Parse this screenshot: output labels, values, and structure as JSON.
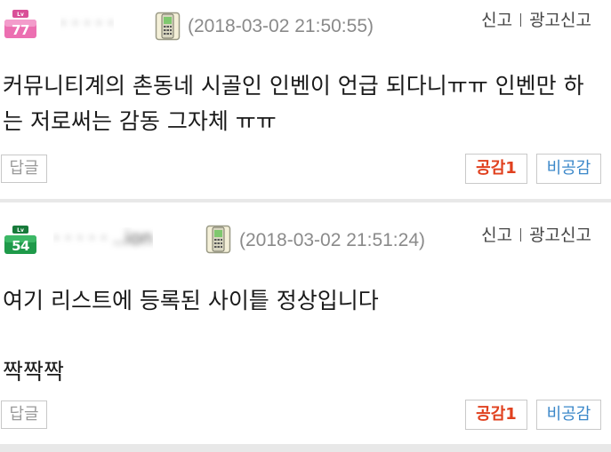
{
  "comments": [
    {
      "level": "77",
      "level_tag": "Lv",
      "badge_color": "#ec6fb1",
      "username": "·  ·  · ·  ·",
      "device_icon": "mobile-phone-icon",
      "timestamp": "(2018-03-02 21:50:55)",
      "report_label": "신고",
      "ad_report_label": "광고신고",
      "body": "커뮤니티계의 촌동네 시골인 인벤이 언급 되다니ㅠㅠ 인벤만 하\n는 저로써는 감동 그자체 ㅠㅠ",
      "reply_label": "답글",
      "like_label": "공감1",
      "dislike_label": "비공감"
    },
    {
      "level": "54",
      "level_tag": "Lv",
      "badge_color": "#1f9a4a",
      "username": "·  · ·   ·  ·  ..ion",
      "device_icon": "mobile-phone-icon",
      "timestamp": "(2018-03-02 21:51:24)",
      "report_label": "신고",
      "ad_report_label": "광고신고",
      "body": "여기 리스트에 등록된 사이틑 정상입니다\n\n짝짝짝",
      "reply_label": "답글",
      "like_label": "공감1",
      "dislike_label": "비공감"
    }
  ],
  "colors": {
    "like": "#e0401e",
    "dislike": "#3a87c9",
    "timestamp": "#8a8a8a",
    "separator": "#e8e8e8"
  }
}
